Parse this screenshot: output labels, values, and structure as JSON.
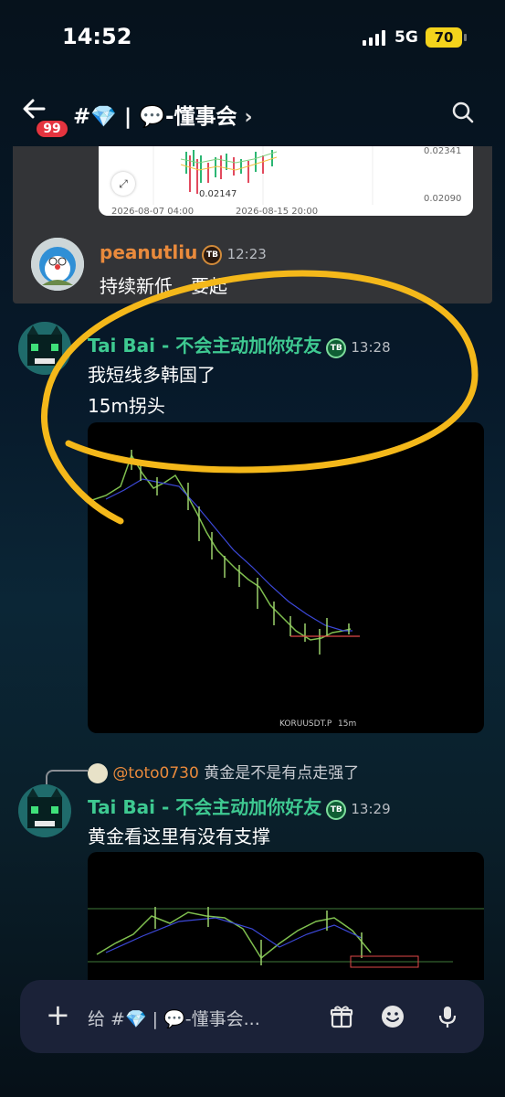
{
  "status_bar": {
    "time": "14:52",
    "network": "5G",
    "battery": "70"
  },
  "header": {
    "unread_count": "99",
    "channel_title": "#💎 | 💬-懂事会",
    "chevron": "›"
  },
  "top_chart": {
    "date_left": "2026-08-07 04:00",
    "date_right": "2026-08-15 20:00",
    "low_label": "0.02147",
    "price_top": "0.02341",
    "price_bottom": "0.02090"
  },
  "messages": [
    {
      "author": "peanutliu",
      "time": "12:23",
      "lines": [
        "持续新低，要起"
      ],
      "name_color": "#e98a3c"
    },
    {
      "author": "Tai Bai - 不会主动加你好友",
      "time": "13:28",
      "lines": [
        "我短线多韩国了",
        "15m拐头"
      ],
      "name_color": "#3ec991",
      "chart_caption": "KORUUSDT.P",
      "chart_interval": "15m"
    },
    {
      "reply_to_user": "@toto0730",
      "reply_text": "黄金是不是有点走强了",
      "author": "Tai Bai - 不会主动加你好友",
      "time": "13:29",
      "lines": [
        "黄金看这里有没有支撑"
      ],
      "name_color": "#3ec991"
    }
  ],
  "composer": {
    "placeholder": "给 #💎 | 💬-懂事会..."
  },
  "icons": [
    "back-arrow-icon",
    "search-icon",
    "plus-icon",
    "gift-icon",
    "emoji-icon",
    "microphone-icon",
    "expand-icon"
  ]
}
